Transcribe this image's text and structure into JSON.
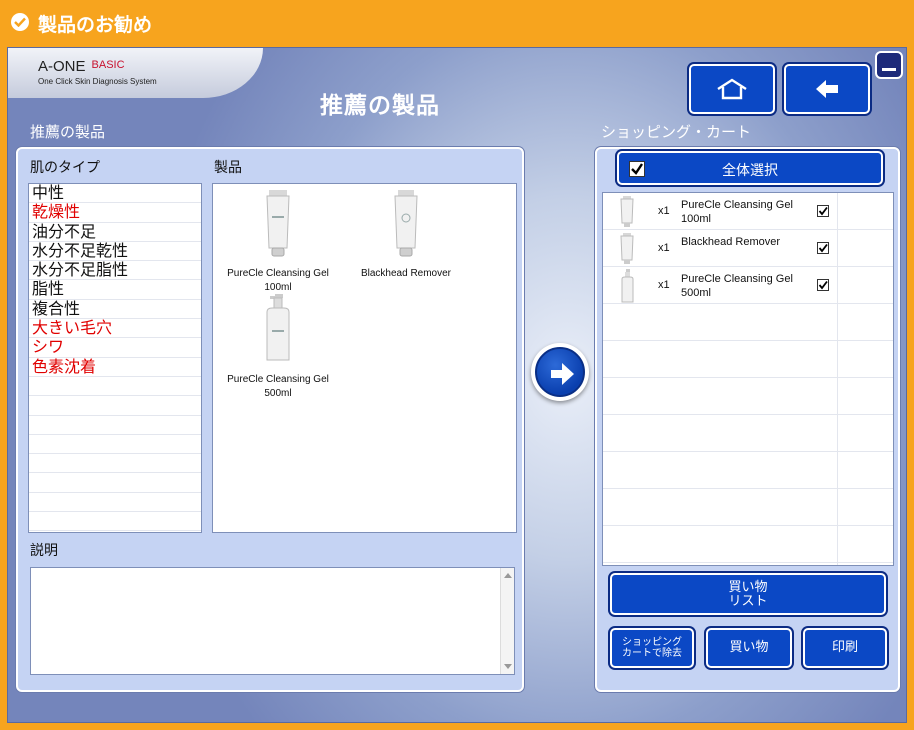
{
  "window": {
    "title": "製品のお勧め",
    "check_icon": "check-circle-icon"
  },
  "logo": {
    "brand": "A-ONE",
    "edition": "BASIC",
    "tagline": "One Click Skin Diagnosis System"
  },
  "page": {
    "title": "推薦の製品"
  },
  "nav": {
    "home_icon": "home-icon",
    "back_icon": "back-arrow-icon",
    "minimize_icon": "minimize-icon"
  },
  "left": {
    "section_label": "推薦の製品",
    "skin_header": "肌のタイプ",
    "product_header": "製品",
    "skin_types": [
      {
        "label": "中性",
        "color": "#111111"
      },
      {
        "label": "乾燥性",
        "color": "#e00000"
      },
      {
        "label": "油分不足",
        "color": "#111111"
      },
      {
        "label": "水分不足乾性",
        "color": "#111111"
      },
      {
        "label": "水分不足脂性",
        "color": "#111111"
      },
      {
        "label": "脂性",
        "color": "#111111"
      },
      {
        "label": "複合性",
        "color": "#111111"
      },
      {
        "label": "大きい毛穴",
        "color": "#e00000"
      },
      {
        "label": "シワ",
        "color": "#e00000"
      },
      {
        "label": "色素沈着",
        "color": "#e00000"
      }
    ],
    "products": [
      {
        "name_line1": "PureCle Cleansing Gel",
        "name_line2": "100ml"
      },
      {
        "name_line1": "Blackhead Remover",
        "name_line2": ""
      },
      {
        "name_line1": "PureCle Cleansing Gel",
        "name_line2": "500ml"
      }
    ],
    "description_header": "説明",
    "description_text": ""
  },
  "right": {
    "section_label": "ショッピング・カート",
    "select_all_label": "全体選択",
    "select_all_checked": true,
    "cart_items": [
      {
        "qty": "x1",
        "name": "PureCle Cleansing Gel 100ml",
        "checked": true
      },
      {
        "qty": "x1",
        "name": "Blackhead Remover",
        "checked": true
      },
      {
        "qty": "x1",
        "name": "PureCle Cleansing Gel 500ml",
        "checked": true
      }
    ],
    "shopping_list_line1": "買い物",
    "shopping_list_line2": "リスト",
    "remove_line1": "ショッピング",
    "remove_line2": "カートで除去",
    "buy_label": "買い物",
    "print_label": "印刷"
  },
  "colors": {
    "frame": "#f7a41e",
    "button": "#0b48c5",
    "panel": "#c5d3f3",
    "highlight_text": "#e00000"
  }
}
